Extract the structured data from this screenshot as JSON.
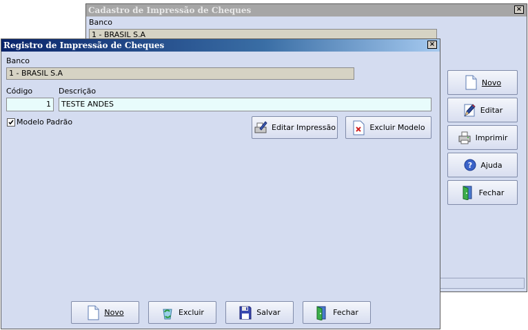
{
  "back_window": {
    "title": "Cadastro de Impressão de Cheques",
    "close_label": "×",
    "banco_label": "Banco",
    "banco_value": "1 - BRASIL S.A",
    "side_buttons": {
      "novo": "Novo",
      "editar": "Editar",
      "imprimir": "Imprimir",
      "ajuda": "Ajuda",
      "fechar": "Fechar"
    }
  },
  "front_window": {
    "title": "Registro de Impressão de Cheques",
    "close_label": "×",
    "banco_label": "Banco",
    "banco_value": "1 - BRASIL S.A",
    "codigo_label": "Código",
    "codigo_value": "1",
    "descricao_label": "Descrição",
    "descricao_value": "TESTE ANDES",
    "modelo_padrao_label": "Modelo Padrão",
    "modelo_padrao_checked": true,
    "editar_impressao_label": "Editar Impressão",
    "excluir_modelo_label": "Excluir Modelo",
    "bottom_buttons": {
      "novo": "Novo",
      "excluir": "Excluir",
      "salvar": "Salvar",
      "fechar": "Fechar"
    }
  },
  "icons": {
    "new": "new-document-icon",
    "edit": "pencil-icon",
    "print": "printer-icon",
    "help": "help-icon",
    "close": "door-icon",
    "delete": "recycle-icon",
    "save": "floppy-disk-icon",
    "remove_model": "delete-document-icon",
    "edit_print": "print-edit-icon"
  },
  "colors": {
    "window_bg": "#d4dcf0",
    "active_title_start": "#0a246a",
    "inactive_title": "#a6a6a6",
    "editable_field": "#e8fcfc",
    "readonly_field": "#d6d3c4"
  }
}
